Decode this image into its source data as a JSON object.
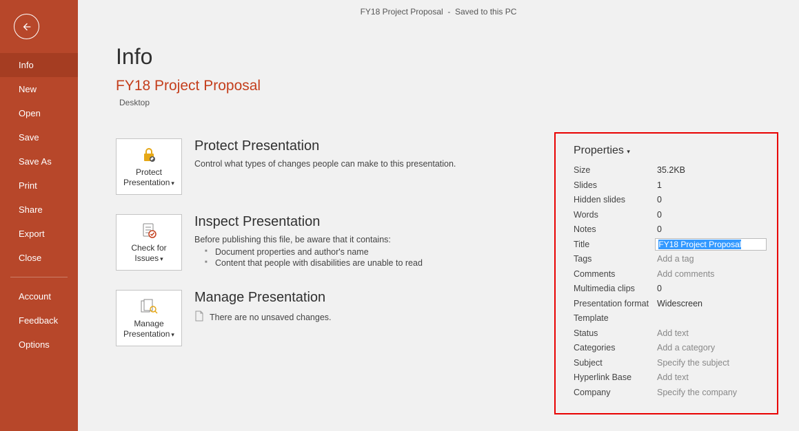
{
  "titlebar": {
    "filename": "FY18 Project Proposal",
    "status": "Saved to this PC"
  },
  "sidebar": {
    "items": [
      "Info",
      "New",
      "Open",
      "Save",
      "Save As",
      "Print",
      "Share",
      "Export",
      "Close"
    ],
    "bottom_items": [
      "Account",
      "Feedback",
      "Options"
    ],
    "active_index": 0
  },
  "page": {
    "title": "Info",
    "doc_title": "FY18 Project Proposal",
    "doc_location": "Desktop"
  },
  "sections": {
    "protect": {
      "tile_line1": "Protect",
      "tile_line2": "Presentation",
      "heading": "Protect Presentation",
      "desc": "Control what types of changes people can make to this presentation."
    },
    "inspect": {
      "tile_line1": "Check for",
      "tile_line2": "Issues",
      "heading": "Inspect Presentation",
      "desc": "Before publishing this file, be aware that it contains:",
      "bullets": [
        "Document properties and author's name",
        "Content that people with disabilities are unable to read"
      ]
    },
    "manage": {
      "tile_line1": "Manage",
      "tile_line2": "Presentation",
      "heading": "Manage Presentation",
      "desc": "There are no unsaved changes."
    }
  },
  "properties": {
    "heading": "Properties",
    "rows": [
      {
        "label": "Size",
        "value": "35.2KB",
        "placeholder": false,
        "is_title": false
      },
      {
        "label": "Slides",
        "value": "1",
        "placeholder": false,
        "is_title": false
      },
      {
        "label": "Hidden slides",
        "value": "0",
        "placeholder": false,
        "is_title": false
      },
      {
        "label": "Words",
        "value": "0",
        "placeholder": false,
        "is_title": false
      },
      {
        "label": "Notes",
        "value": "0",
        "placeholder": false,
        "is_title": false
      },
      {
        "label": "Title",
        "value": "FY18 Project Proposal",
        "placeholder": false,
        "is_title": true
      },
      {
        "label": "Tags",
        "value": "Add a tag",
        "placeholder": true,
        "is_title": false
      },
      {
        "label": "Comments",
        "value": "Add comments",
        "placeholder": true,
        "is_title": false
      },
      {
        "label": "Multimedia clips",
        "value": "0",
        "placeholder": false,
        "is_title": false
      },
      {
        "label": "Presentation format",
        "value": "Widescreen",
        "placeholder": false,
        "is_title": false
      },
      {
        "label": "Template",
        "value": "",
        "placeholder": false,
        "is_title": false
      },
      {
        "label": "Status",
        "value": "Add text",
        "placeholder": true,
        "is_title": false
      },
      {
        "label": "Categories",
        "value": "Add a category",
        "placeholder": true,
        "is_title": false
      },
      {
        "label": "Subject",
        "value": "Specify the subject",
        "placeholder": true,
        "is_title": false
      },
      {
        "label": "Hyperlink Base",
        "value": "Add text",
        "placeholder": true,
        "is_title": false
      },
      {
        "label": "Company",
        "value": "Specify the company",
        "placeholder": true,
        "is_title": false
      }
    ]
  }
}
